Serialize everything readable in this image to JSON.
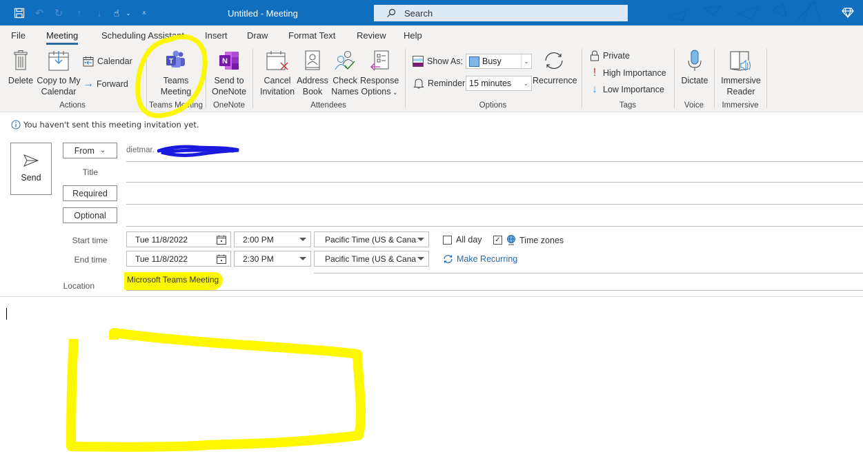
{
  "window": {
    "title": "Untitled  -  Meeting",
    "search_placeholder": "Search",
    "quick_access": [
      "save-icon",
      "undo-icon",
      "redo-icon",
      "up-icon",
      "down-icon",
      "touch-mode-icon",
      "customize-icon"
    ]
  },
  "tabs": [
    {
      "label": "File"
    },
    {
      "label": "Meeting",
      "active": true
    },
    {
      "label": "Scheduling Assistant"
    },
    {
      "label": "Insert"
    },
    {
      "label": "Draw"
    },
    {
      "label": "Format Text"
    },
    {
      "label": "Review"
    },
    {
      "label": "Help"
    }
  ],
  "ribbon": {
    "actions": {
      "group_label": "Actions",
      "delete": "Delete",
      "copy_line1": "Copy to My",
      "copy_line2": "Calendar",
      "calendar": "Calendar",
      "forward": "Forward"
    },
    "teams": {
      "group_label": "Teams Meeting",
      "line1": "Teams",
      "line2": "Meeting"
    },
    "onenote": {
      "group_label": "OneNote",
      "line1": "Send to",
      "line2": "OneNote"
    },
    "attendees": {
      "group_label": "Attendees",
      "cancel_line1": "Cancel",
      "cancel_line2": "Invitation",
      "address_line1": "Address",
      "address_line2": "Book",
      "check_line1": "Check",
      "check_line2": "Names",
      "response_line1": "Response",
      "response_line2": "Options"
    },
    "options": {
      "group_label": "Options",
      "show_as_label": "Show As:",
      "show_as_value": "Busy",
      "reminder_label": "Reminder:",
      "reminder_value": "15 minutes",
      "recurrence": "Recurrence",
      "busy_color": "#7fb8e6"
    },
    "tags": {
      "group_label": "Tags",
      "private": "Private",
      "high": "High Importance",
      "low": "Low Importance"
    },
    "voice": {
      "group_label": "Voice",
      "dictate": "Dictate"
    },
    "immersive": {
      "group_label": "Immersive",
      "line1": "Immersive",
      "line2": "Reader"
    }
  },
  "infobar": {
    "message": "You haven't sent this meeting invitation yet."
  },
  "form": {
    "send_label": "Send",
    "from_label": "From",
    "from_value": "dietmar.",
    "title_label": "Title",
    "title_value": "",
    "required_label": "Required",
    "required_value": "",
    "optional_label": "Optional",
    "optional_value": "",
    "start_label": "Start time",
    "start_date": "Tue 11/8/2022",
    "start_time": "2:00 PM",
    "start_tz": "Pacific Time (US & Canac",
    "end_label": "End time",
    "end_date": "Tue 11/8/2022",
    "end_time": "2:30 PM",
    "end_tz": "Pacific Time (US & Canac",
    "all_day_label": "All day",
    "all_day_checked": false,
    "time_zones_label": "Time zones",
    "time_zones_checked": true,
    "make_recurring": "Make Recurring",
    "location_label": "Location",
    "location_value": "Microsoft Teams Meeting"
  },
  "colors": {
    "title_bar": "#106ebe",
    "accent": "#2b6aa8",
    "highlight": "#fdf800",
    "teams_purple": "#5b5fc7",
    "onenote_purple": "#7719aa"
  }
}
